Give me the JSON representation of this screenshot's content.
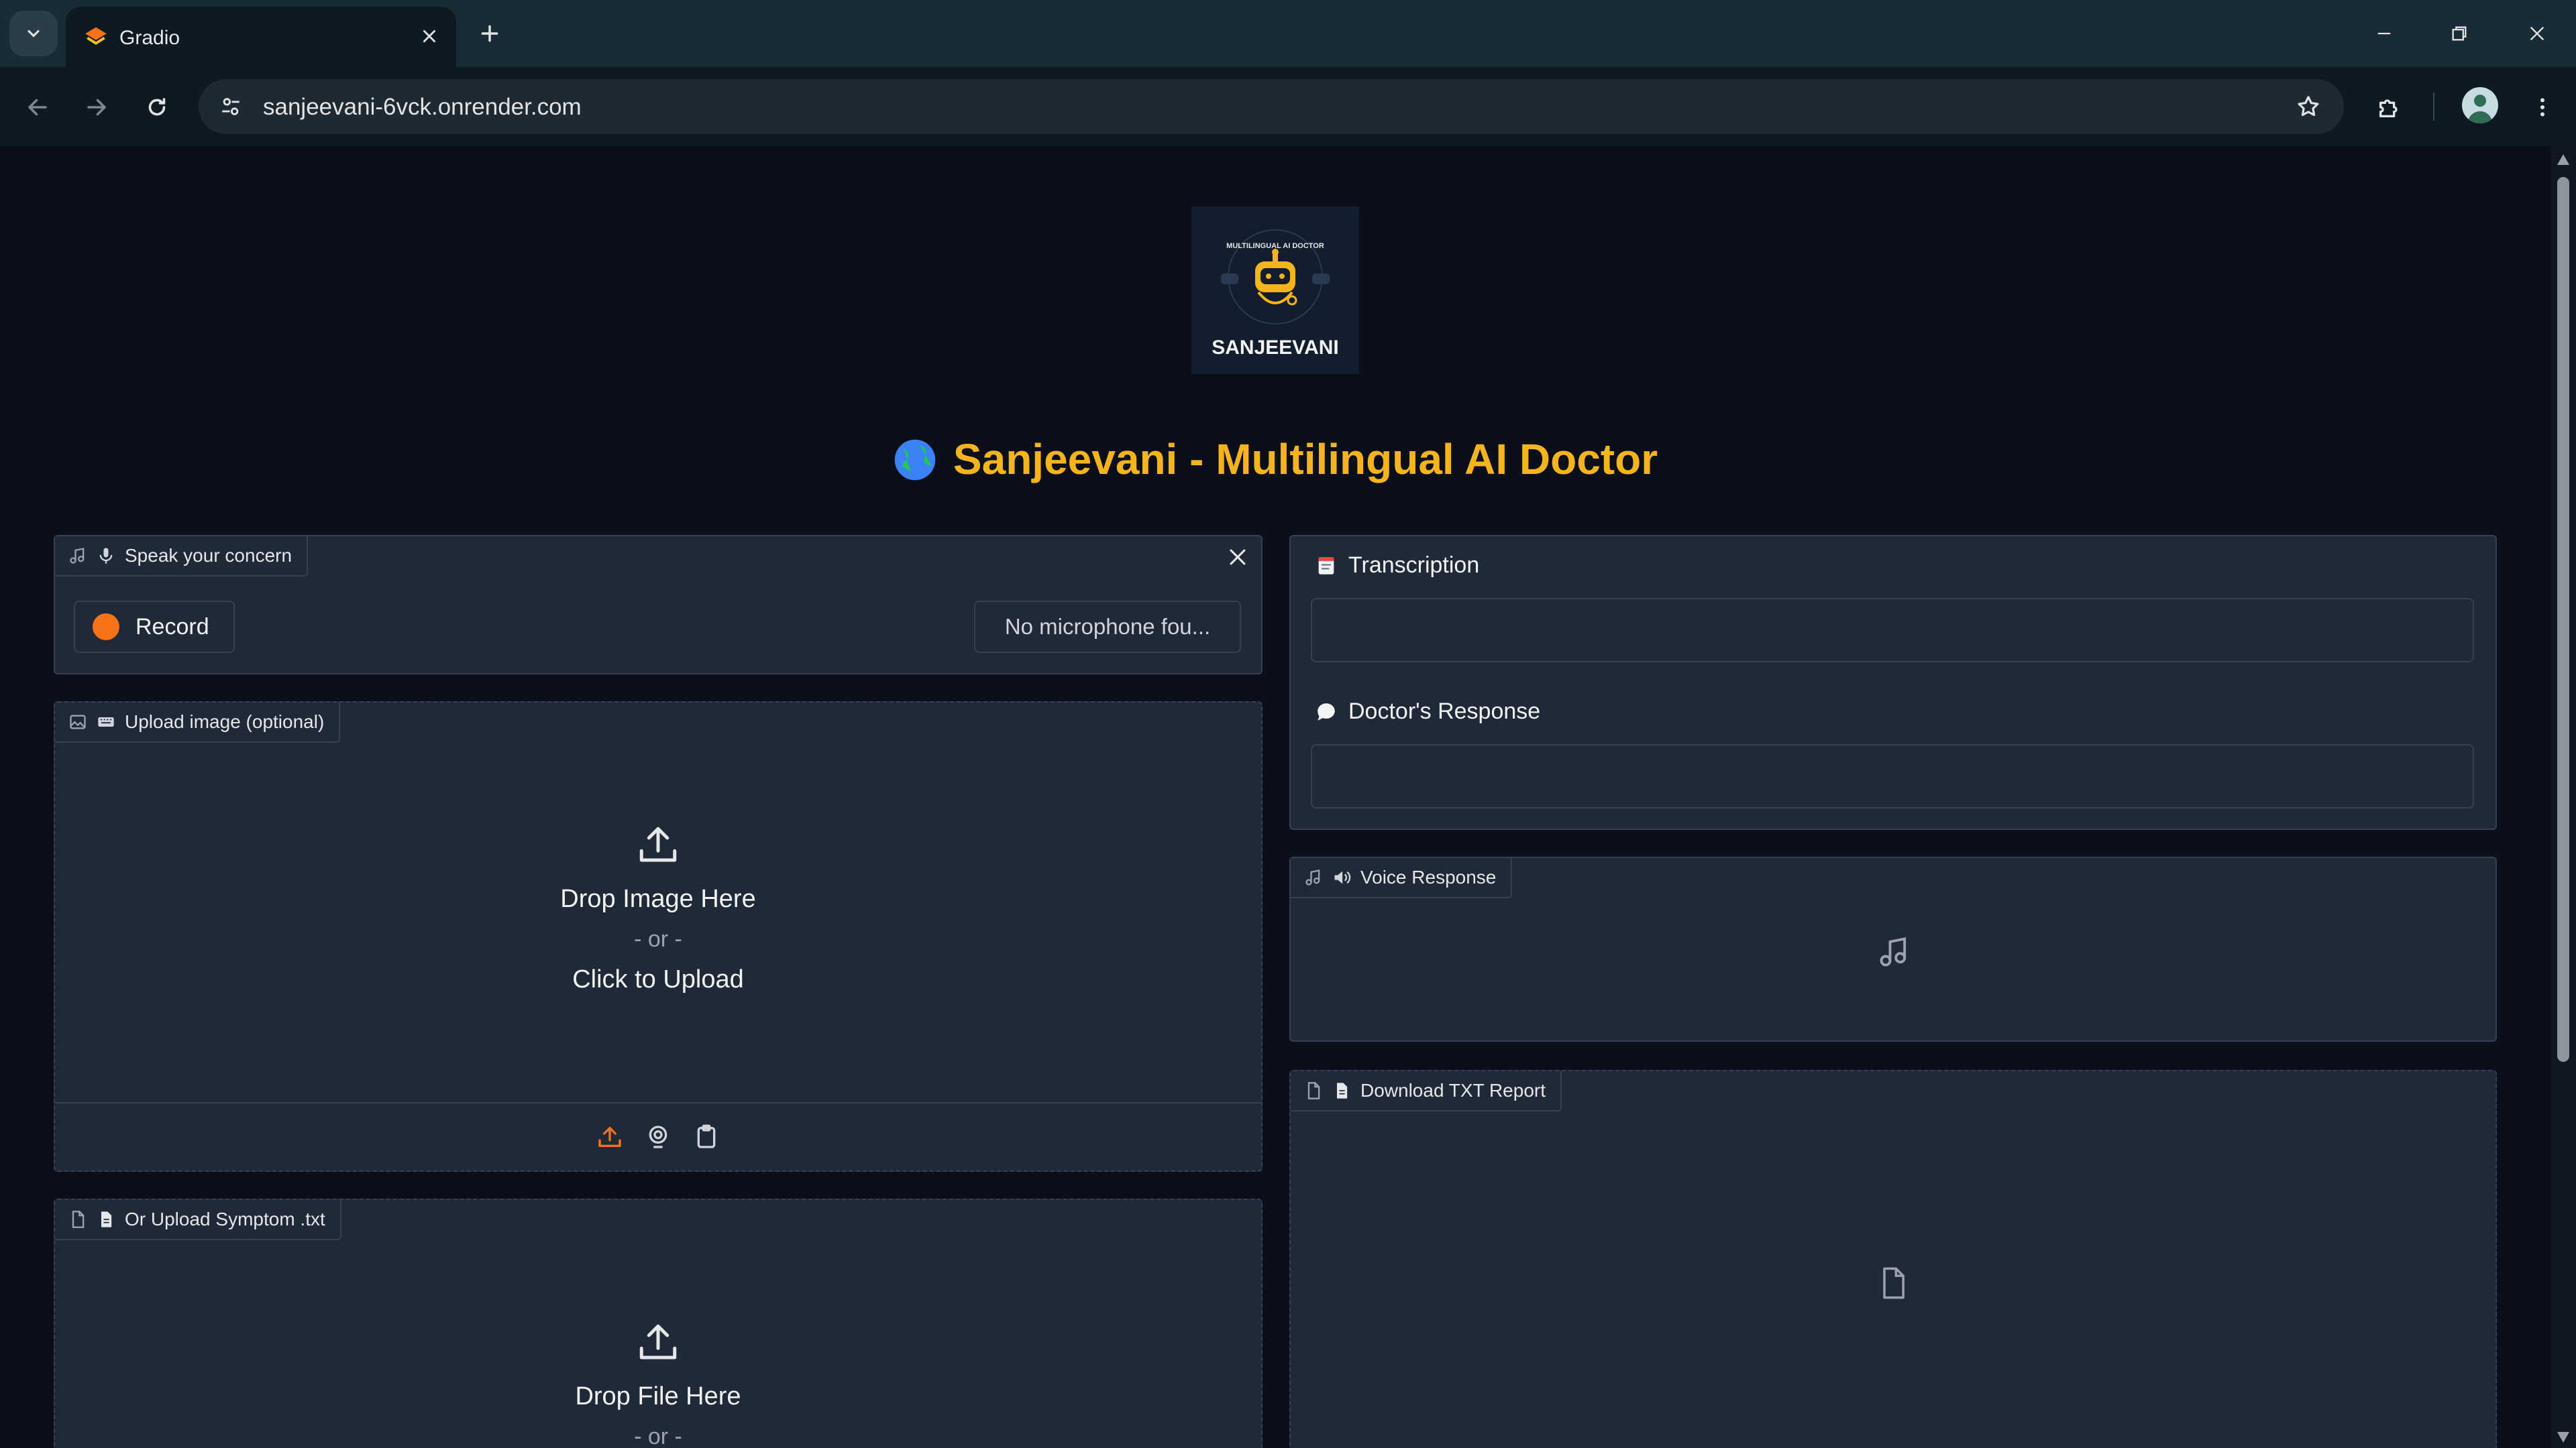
{
  "browser": {
    "tab_title": "Gradio",
    "url": "sanjeevani-6vck.onrender.com"
  },
  "app": {
    "logo_text": "SANJEEVANI",
    "logo_ring_text": "MULTILINGUAL AI DOCTOR",
    "title": "Sanjeevani - Multilingual AI Doctor",
    "accent_color": "#f5b41a"
  },
  "audio_input": {
    "label": "Speak your concern",
    "record_label": "Record",
    "mic_status": "No microphone fou..."
  },
  "image_input": {
    "label": "Upload image (optional)",
    "drop_text": "Drop Image Here",
    "or_text": "- or -",
    "click_text": "Click to Upload"
  },
  "file_input": {
    "label": "Or Upload Symptom .txt",
    "drop_text": "Drop File Here",
    "or_text": "- or -"
  },
  "outputs": {
    "transcription_label": "Transcription",
    "transcription_value": "",
    "response_label": "Doctor's Response",
    "response_value": "",
    "voice_label": "Voice Response",
    "report_label": "Download TXT Report"
  }
}
